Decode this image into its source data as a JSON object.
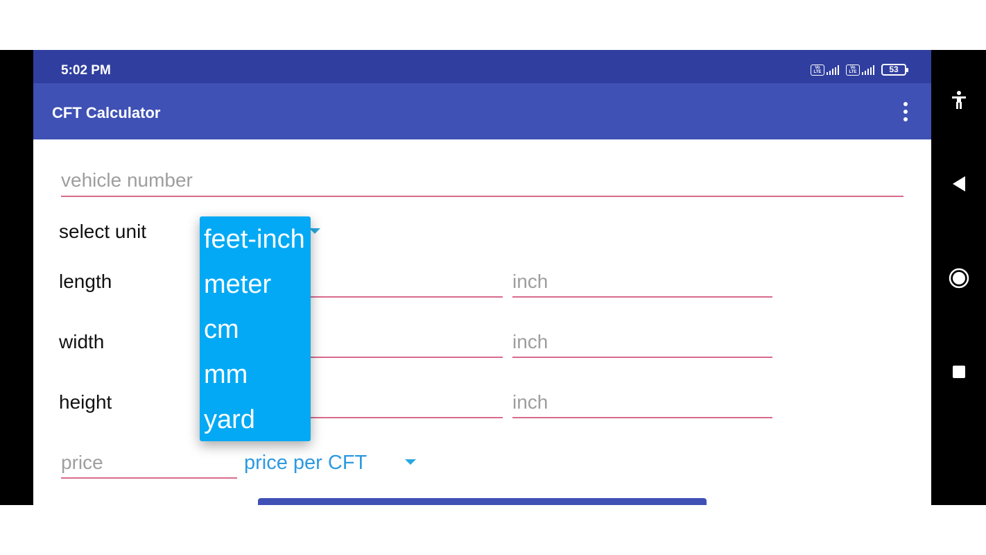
{
  "status_bar": {
    "time": "5:02 PM",
    "sim1": "Vo LTE",
    "sim2": "Vo LTE",
    "battery": "53"
  },
  "app_bar": {
    "title": "CFT Calculator",
    "menu_icon": "more-vert-icon"
  },
  "form": {
    "vehicle_number_placeholder": "vehicle number",
    "select_unit_label": "select unit",
    "length_label": "length",
    "width_label": "width",
    "height_label": "height",
    "length_inch_placeholder": "inch",
    "width_inch_placeholder": "inch",
    "height_inch_placeholder": "inch",
    "price_placeholder": "price",
    "price_unit_selected": "price per CFT"
  },
  "unit_dropdown": {
    "options": [
      "feet-inch",
      "meter",
      "cm",
      "mm",
      "yard"
    ]
  },
  "nav_bar": {
    "icons": [
      "accessibility-icon",
      "back-icon",
      "home-icon",
      "recents-icon"
    ]
  },
  "colors": {
    "status_bar": "#303f9f",
    "app_bar": "#3f51b5",
    "dropdown": "#03a9f4",
    "underline": "#d96a8c",
    "accent_text": "#2d9ae0"
  }
}
